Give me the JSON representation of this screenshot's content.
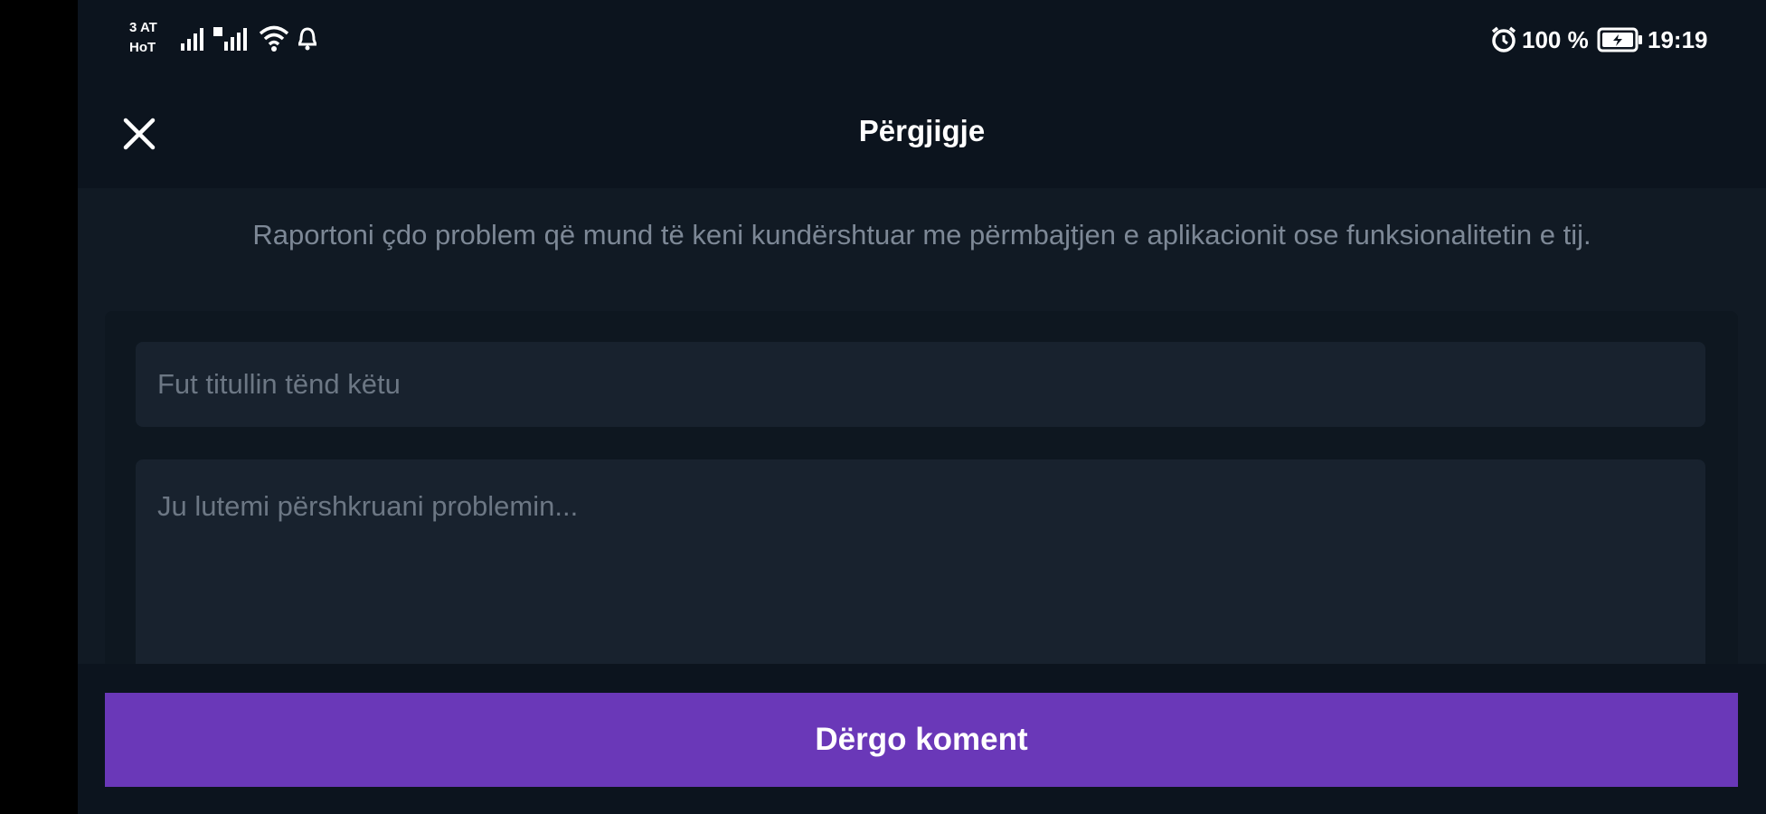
{
  "status_bar": {
    "carrier_line1": "3 AT",
    "carrier_line2": "HoT",
    "battery_percent": "100 %",
    "time": "19:19",
    "icons": [
      "signal-icon",
      "signal-icon",
      "wifi-icon",
      "notification-icon",
      "alarm-icon",
      "battery-icon"
    ]
  },
  "header": {
    "title": "Përgjigje",
    "close_icon": "close-icon"
  },
  "main": {
    "description": "Raportoni çdo problem që mund të keni kundërshtuar me përmbajtjen e aplikacionit ose funksionalitetin e tij.",
    "title_input": {
      "value": "",
      "placeholder": "Fut titullin tënd këtu"
    },
    "description_input": {
      "value": "",
      "placeholder": "Ju lutemi përshkruani problemin..."
    }
  },
  "footer": {
    "submit_label": "Dërgo koment"
  },
  "colors": {
    "accent": "#6a38b8",
    "background": "#111a24",
    "header_background": "#0c141e",
    "input_background": "#18222e"
  }
}
